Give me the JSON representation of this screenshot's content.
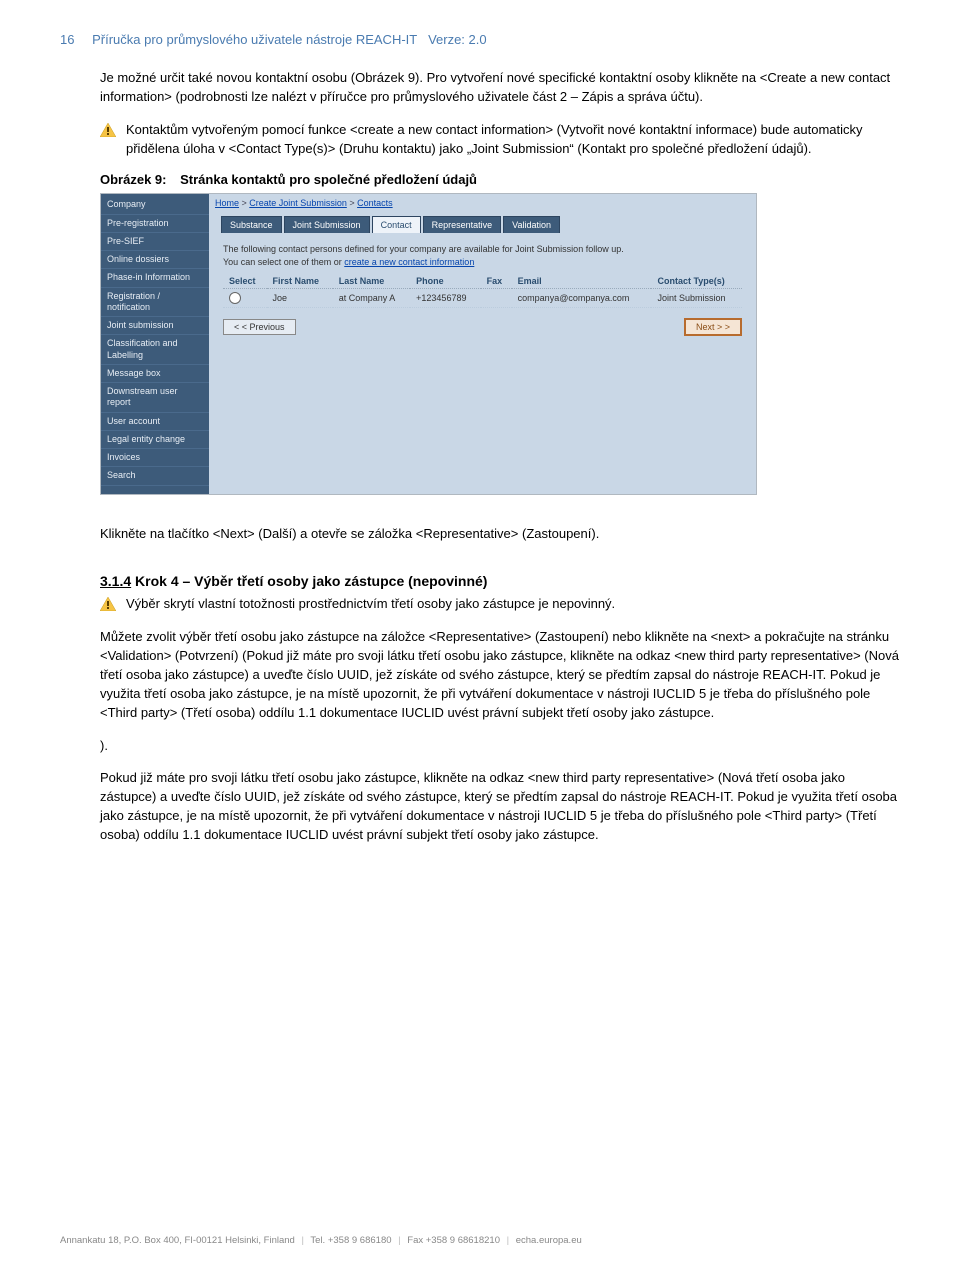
{
  "header": {
    "page_number": "16",
    "title": "Příručka pro průmyslového uživatele nástroje REACH-IT",
    "version_label": "Verze: 2.0"
  },
  "para1": "Je možné určit také novou kontaktní osobu (Obrázek 9). Pro vytvoření nové specifické kontaktní osoby klikněte na <Create a new contact information> (podrobnosti lze nalézt v příručce pro průmyslového uživatele část 2 – Zápis a správa účtu).",
  "warn1": "Kontaktům vytvořeným pomocí funkce <create a new contact information> (Vytvořit nové kontaktní informace) bude automaticky přidělena úloha v <Contact Type(s)> (Druhu kontaktu) jako „Joint Submission“ (Kontakt pro společné předložení údajů).",
  "figure": {
    "label": "Obrázek 9:",
    "caption": "Stránka kontaktů pro společné předložení údajů"
  },
  "screenshot": {
    "breadcrumb": [
      "Home",
      "Create Joint Submission",
      "Contacts"
    ],
    "sidebar": [
      "Company",
      "Pre-registration",
      "Pre-SIEF",
      "Online dossiers",
      "Phase-in Information",
      "Registration / notification",
      "Joint submission",
      "Classification and Labelling",
      "Message box",
      "Downstream user report",
      "User account",
      "Legal entity change",
      "Invoices",
      "Search"
    ],
    "tabs": [
      "Substance",
      "Joint Submission",
      "Contact",
      "Representative",
      "Validation"
    ],
    "active_tab": 2,
    "desc_line1": "The following contact persons defined for your company are available for Joint Submission follow up.",
    "desc_line2_a": "You can select one of them or ",
    "desc_line2_link": "create a new contact information",
    "table": {
      "headers": [
        "Select",
        "First Name",
        "Last Name",
        "Phone",
        "Fax",
        "Email",
        "Contact Type(s)"
      ],
      "row": {
        "first": "Joe",
        "last": "at Company A",
        "phone": "+123456789",
        "fax": "",
        "email": "companya@companya.com",
        "type": "Joint Submission"
      }
    },
    "btn_prev": "< < Previous",
    "btn_next": "Next > >"
  },
  "para2": "Klikněte na tlačítko <Next> (Další) a otevře se záložka <Representative> (Zastoupení).",
  "section": {
    "number": "3.1.4",
    "title": "Krok 4 – Výběr třetí osoby jako zástupce (nepovinné)"
  },
  "warn2": "Výběr skrytí vlastní totožnosti prostřednictvím třetí osoby jako zástupce je nepovinný.",
  "para3": "Můžete zvolit výběr třetí osobu jako zástupce na záložce <Representative> (Zastoupení) nebo klikněte na <next> a pokračujte na stránku <Validation> (Potvrzení) (Pokud již máte pro svoji látku třetí osobu jako zástupce, klikněte na odkaz <new third party representative> (Nová třetí osoba jako zástupce) a uveďte číslo UUID, jež získáte od svého zástupce, který se předtím zapsal do nástroje REACH-IT. Pokud je využita třetí osoba jako zástupce, je na místě upozornit, že při vytváření dokumentace v nástroji IUCLID 5 je třeba do příslušného pole <Third party> (Třetí osoba) oddílu 1.1 dokumentace IUCLID uvést právní subjekt třetí osoby jako zástupce.",
  "para3b": ").",
  "para4": "Pokud již máte pro svoji látku třetí osobu jako zástupce, klikněte na odkaz <new third party representative> (Nová třetí osoba jako zástupce) a uveďte číslo UUID, jež získáte od svého zástupce, který se předtím zapsal do nástroje REACH-IT. Pokud je využita třetí osoba jako zástupce, je na místě upozornit, že při vytváření dokumentace v nástroji IUCLID 5 je třeba do příslušného pole <Third party> (Třetí osoba) oddílu 1.1 dokumentace IUCLID uvést právní subjekt třetí osoby jako zástupce.",
  "footer": {
    "address": "Annankatu 18, P.O. Box 400, FI-00121 Helsinki, Finland",
    "tel_label": "Tel.",
    "tel": "+358 9 686180",
    "fax_label": "Fax",
    "fax": "+358 9 68618210",
    "site": "echa.europa.eu"
  }
}
